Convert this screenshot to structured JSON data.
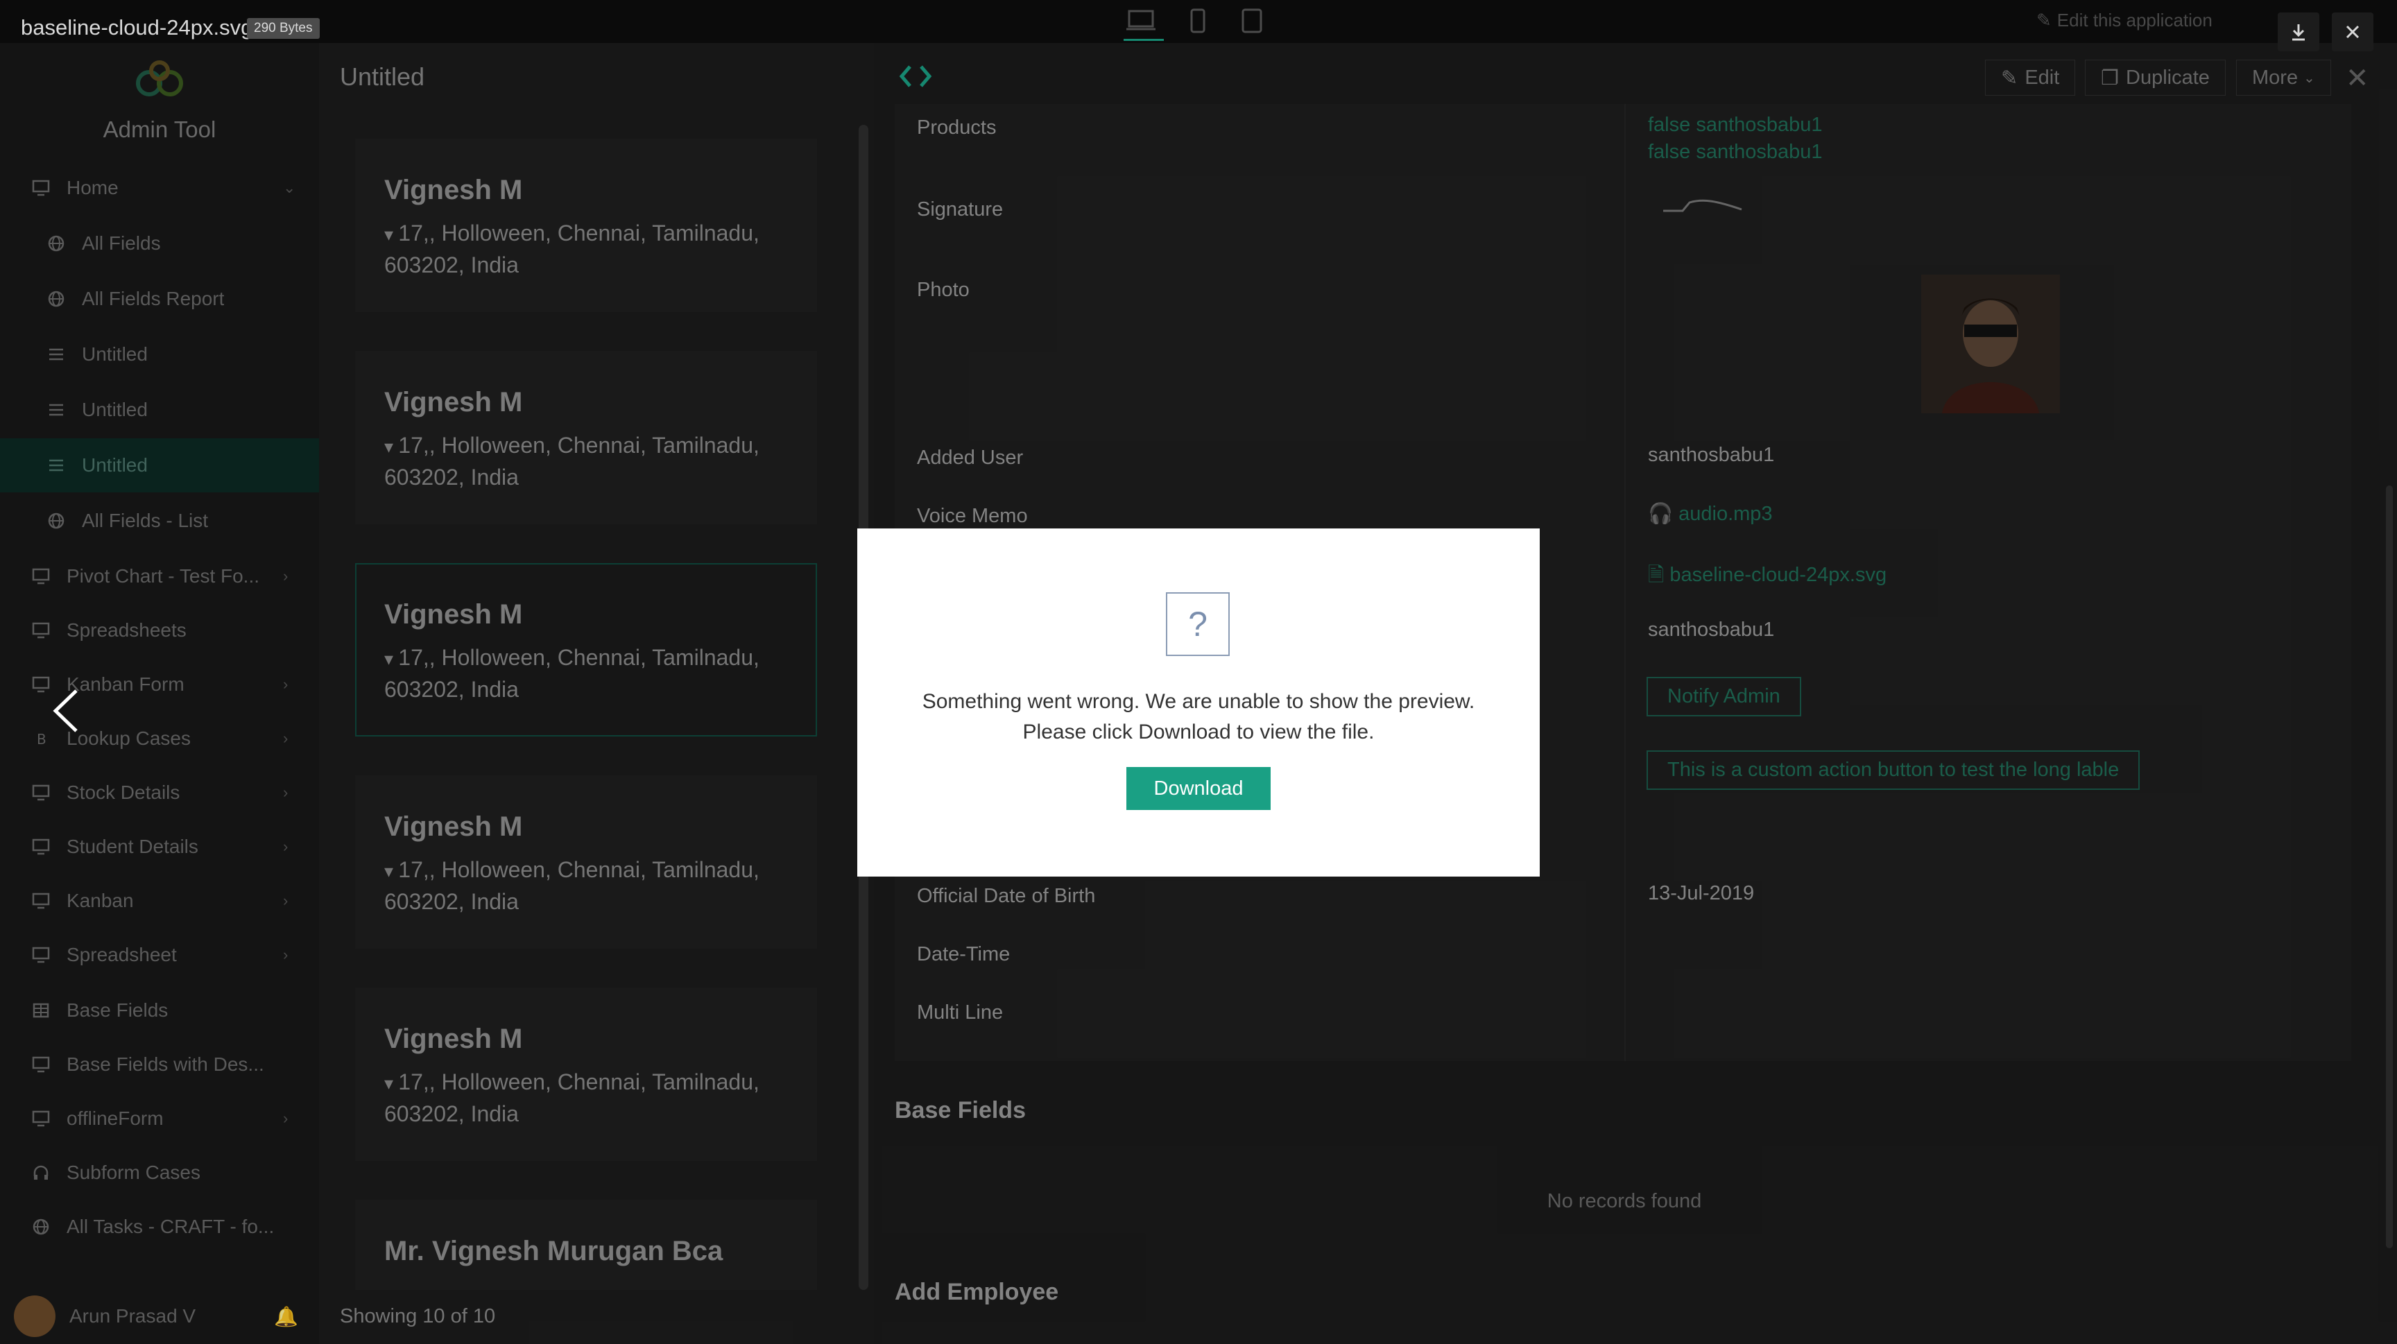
{
  "viewer": {
    "file_name": "baseline-cloud-24px.svg",
    "file_size": "290 Bytes",
    "error_line1": "Something went wrong. We are unable to show the preview.",
    "error_line2": "Please click Download to view the file.",
    "download_label": "Download",
    "question_mark": "?"
  },
  "header": {
    "app_title_hidden": "Admin Tool",
    "edit_app_label": "Edit this application"
  },
  "sidebar": {
    "app_name": "Admin Tool",
    "items": [
      {
        "label": "Home",
        "icon": "monitor-icon",
        "chevron": "down"
      },
      {
        "label": "All Fields",
        "icon": "globe-icon"
      },
      {
        "label": "All Fields Report",
        "icon": "globe-icon"
      },
      {
        "label": "Untitled",
        "icon": "list-icon"
      },
      {
        "label": "Untitled",
        "icon": "list-icon"
      },
      {
        "label": "Untitled",
        "icon": "list-icon",
        "active": true
      },
      {
        "label": "All Fields - List",
        "icon": "globe-icon"
      },
      {
        "label": "Pivot Chart - Test Fo...",
        "icon": "monitor-icon",
        "chevron": "right"
      },
      {
        "label": "Spreadsheets",
        "icon": "monitor-icon"
      },
      {
        "label": "Kanban Form",
        "icon": "monitor-icon",
        "chevron": "right"
      },
      {
        "label": "Lookup Cases",
        "icon": "bitcoin-icon",
        "chevron": "right"
      },
      {
        "label": "Stock Details",
        "icon": "monitor-icon",
        "chevron": "right"
      },
      {
        "label": "Student Details",
        "icon": "monitor-icon",
        "chevron": "right"
      },
      {
        "label": "Kanban",
        "icon": "monitor-icon",
        "chevron": "right"
      },
      {
        "label": "Spreadsheet",
        "icon": "monitor-icon",
        "chevron": "right"
      },
      {
        "label": "Base Fields",
        "icon": "table-icon"
      },
      {
        "label": "Base Fields with Des...",
        "icon": "monitor-icon"
      },
      {
        "label": "offlineForm",
        "icon": "monitor-icon",
        "chevron": "right"
      },
      {
        "label": "Subform Cases",
        "icon": "headphones-icon"
      },
      {
        "label": "All Tasks - CRAFT - fo...",
        "icon": "globe-icon"
      }
    ],
    "user_name": "Arun Prasad V"
  },
  "list": {
    "title": "Untitled",
    "cards": [
      {
        "name": "Vignesh M",
        "address": "17,, Holloween, Chennai, Tamilnadu, 603202, India"
      },
      {
        "name": "Vignesh M",
        "address": "17,, Holloween, Chennai, Tamilnadu, 603202, India"
      },
      {
        "name": "Vignesh M",
        "address": "17,, Holloween, Chennai, Tamilnadu, 603202, India",
        "selected": true
      },
      {
        "name": "Vignesh M",
        "address": "17,, Holloween, Chennai, Tamilnadu, 603202, India"
      },
      {
        "name": "Vignesh M",
        "address": "17,, Holloween, Chennai, Tamilnadu, 603202, India"
      },
      {
        "name": "Mr. Vignesh Murugan Bca",
        "address": ""
      }
    ],
    "showing": "Showing 10 of 10"
  },
  "toolbar": {
    "edit": "Edit",
    "duplicate": "Duplicate",
    "more": "More"
  },
  "detail": {
    "fields": [
      {
        "label": "Products",
        "values": [
          "false santhosbabu1",
          "false santhosbabu1"
        ],
        "link": true
      },
      {
        "label": "Signature"
      },
      {
        "label": "Photo"
      },
      {
        "label": "Added User",
        "values": [
          "santhosbabu1"
        ]
      },
      {
        "label": "Voice Memo",
        "values": [
          "audio.mp3"
        ],
        "link": true
      }
    ],
    "file_link": "baseline-cloud-24px.svg",
    "user2": "santhosbabu1",
    "notify_admin": "Notify Admin",
    "custom_action": "This is a custom action button to test the long lable",
    "official_dob_label": "Official Date of Birth",
    "official_dob_value": "13-Jul-2019",
    "date_time_label": "Date-Time",
    "multi_line_label": "Multi Line",
    "section_base_fields": "Base Fields",
    "no_records": "No records found",
    "section_add_employee": "Add Employee"
  },
  "colors": {
    "accent": "#1aa084",
    "link_dim": "#1f6e58",
    "active_nav_bg": "#0c2a24"
  }
}
